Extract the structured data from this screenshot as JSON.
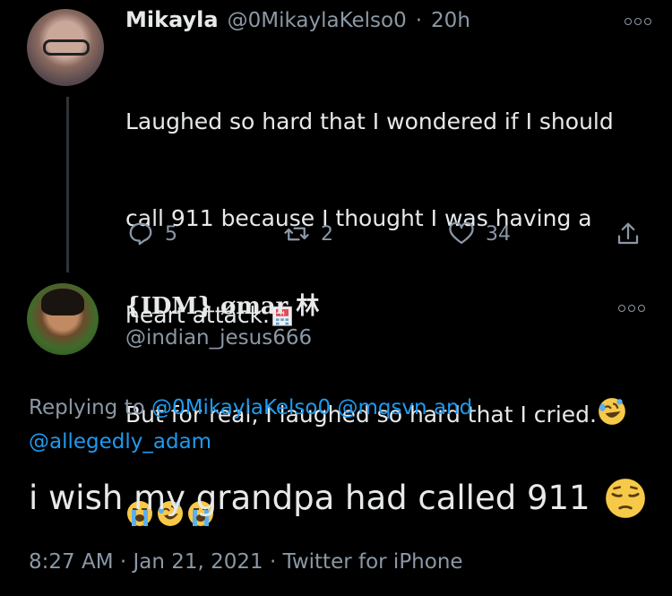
{
  "reply_to_tweet": {
    "display_name": "Mikayla",
    "handle": "@0MikaylaKelso0",
    "separator": "·",
    "time_ago": "20h",
    "text_line1": "Laughed so hard that I wondered if I should",
    "text_line2": "call 911 because I thought I was having a",
    "text_line3": "heart attack.",
    "text_line4": "But for real, I laughed so hard that I cried.",
    "emoji_names": [
      "hospital-emoji",
      "rolling-on-floor-laughing-emoji",
      "loudly-crying-emoji",
      "rolling-on-floor-laughing-emoji",
      "loudly-crying-emoji"
    ],
    "actions": {
      "reply_count": "5",
      "retweet_count": "2",
      "like_count": "34"
    }
  },
  "main_tweet": {
    "display_name": "{IDM} ømar 林",
    "handle": "@indian_jesus666",
    "replying_prefix": "Replying to",
    "replying_user1": "@0MikaylaKelso0",
    "replying_user2": "@mqsvn",
    "replying_and": "and",
    "replying_user3": "@allegedly_adam",
    "text": "i wish my grandpa had called 911",
    "emoji_name": "pensive-face-emoji",
    "timestamp": "8:27 AM · Jan 21, 2021 · Twitter for iPhone"
  },
  "colors": {
    "background": "#000000",
    "text": "#e7e9ea",
    "muted": "#8b98a5",
    "link": "#1d9bf0"
  }
}
